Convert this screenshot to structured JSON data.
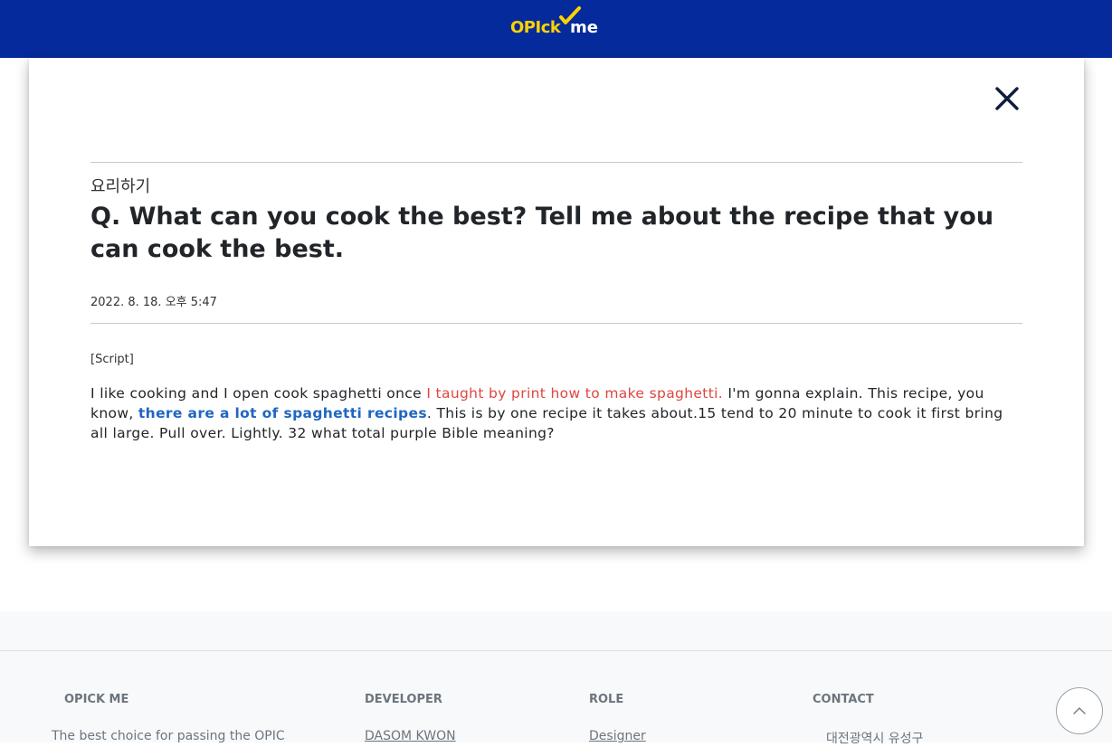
{
  "header": {
    "logo_main": "OPIck",
    "logo_suffix": "me",
    "brand_color": "#052a9b"
  },
  "modal": {
    "close_icon": "close-icon",
    "category": "요리하기",
    "title": "Q. What can you cook the best? Tell me about the recipe that you can cook the best.",
    "date": "2022. 8. 18. 오후 5:47",
    "script_label": "[Script]",
    "script": {
      "part1": "I like cooking and I open cook spaghetti once ",
      "highlight_red": "I taught by print how to make spaghetti.",
      "part2": " I'm gonna explain. This recipe, you know, ",
      "highlight_blue": "there are a lot of spaghetti recipes",
      "part3": ". This is by one recipe it takes about.15 tend to 20 minute to cook it first bring all large. Pull over. Lightly. 32 what total purple Bible meaning?"
    },
    "highlight_colors": {
      "red": "#e0463f",
      "blue": "#1f66c2"
    }
  },
  "footer": {
    "col1": {
      "heading": "OPICK ME",
      "text": "The best choice for passing the OPIC"
    },
    "col2": {
      "heading": "DEVELOPER",
      "text": "DASOM KWON"
    },
    "col3": {
      "heading": "ROLE",
      "text": "Designer"
    },
    "col4": {
      "heading": "CONTACT",
      "text": "대전광역시 유성구"
    },
    "scroll_top_icon": "chevron-up-icon"
  }
}
